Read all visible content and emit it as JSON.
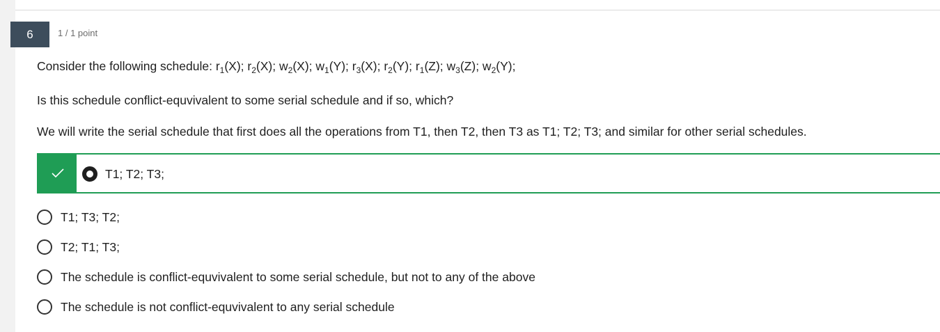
{
  "question": {
    "number": "6",
    "points": "1 / 1 point",
    "schedule_prefix": "Consider the following schedule: ",
    "schedule_ops": [
      {
        "op": "r",
        "t": "1",
        "obj": "(X); "
      },
      {
        "op": "r",
        "t": "2",
        "obj": "(X); "
      },
      {
        "op": "w",
        "t": "2",
        "obj": "(X); "
      },
      {
        "op": "w",
        "t": "1",
        "obj": "(Y); "
      },
      {
        "op": "r",
        "t": "3",
        "obj": "(X); "
      },
      {
        "op": "r",
        "t": "2",
        "obj": "(Y); "
      },
      {
        "op": "r",
        "t": "1",
        "obj": "(Z); "
      },
      {
        "op": "w",
        "t": "3",
        "obj": "(Z); "
      },
      {
        "op": "w",
        "t": "2",
        "obj": "(Y);"
      }
    ],
    "prompt": "Is this schedule conflict-equvivalent to some serial schedule and if so, which?",
    "note": "We will write the serial schedule that first does all the operations from T1, then T2, then T3 as T1; T2; T3; and similar for other serial schedules."
  },
  "options": [
    {
      "label": "T1; T2; T3;",
      "selected": true,
      "correct": true
    },
    {
      "label": "T1; T3; T2;",
      "selected": false
    },
    {
      "label": "T2; T1; T3;",
      "selected": false
    },
    {
      "label": "The schedule is conflict-equvivalent to some serial schedule, but not to any of the above",
      "selected": false
    },
    {
      "label": "The schedule is not conflict-equvivalent to any serial schedule",
      "selected": false
    }
  ],
  "colors": {
    "correct": "#1f9d55",
    "badge": "#3d4d5c"
  },
  "icons": {
    "correct": "check-icon"
  }
}
